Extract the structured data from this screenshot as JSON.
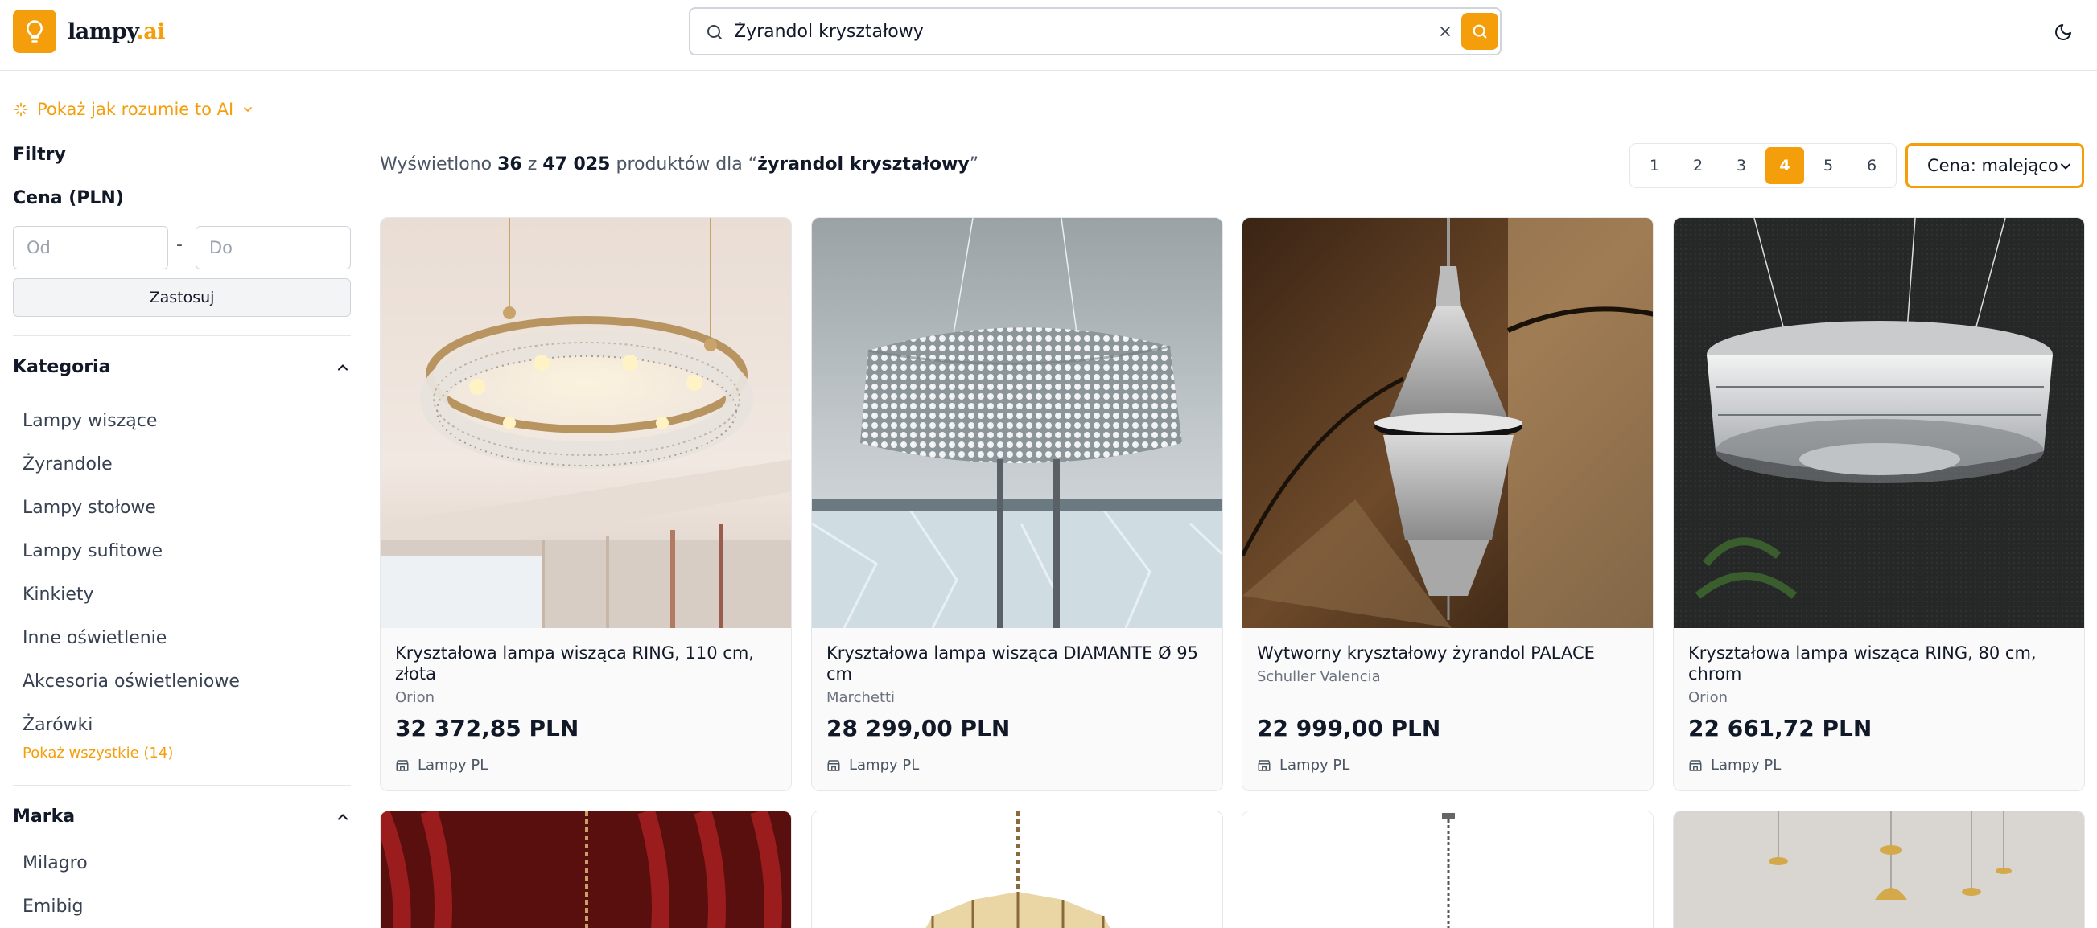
{
  "header": {
    "logo_text": "lampy",
    "logo_suffix": ".ai",
    "icons": [
      "lightbulb-icon",
      "search-icon",
      "close-icon",
      "moon-icon"
    ],
    "search": {
      "value": "Żyrandol kryształowy"
    }
  },
  "sidebar": {
    "ai_link": "Pokaż jak rozumie to AI",
    "filters_title": "Filtry",
    "price_title": "Cena (PLN)",
    "price_from_placeholder": "Od",
    "price_dash": "-",
    "price_to_placeholder": "Do",
    "apply_label": "Zastosuj",
    "category": {
      "title": "Kategoria",
      "items": [
        "Lampy wiszące",
        "Żyrandole",
        "Lampy stołowe",
        "Lampy sufitowe",
        "Kinkiety",
        "Inne oświetlenie",
        "Akcesoria oświetleniowe",
        "Żarówki"
      ],
      "show_all": "Pokaż wszystkie (14)"
    },
    "brand": {
      "title": "Marka",
      "items": [
        "Milagro",
        "Emibig"
      ]
    }
  },
  "results": {
    "prefix": "Wyświetlono",
    "shown": "36",
    "of_word": "z",
    "total": "47 025",
    "middle": "produktów dla “",
    "query": "żyrandol kryształowy",
    "suffix": "”"
  },
  "pagination": {
    "pages": [
      "1",
      "2",
      "3",
      "4",
      "5",
      "6"
    ],
    "active": "4"
  },
  "sort": {
    "value": "Cena: malejąco"
  },
  "accent_color": "#f59e0b",
  "products": [
    {
      "title": "Kryształowa lampa wisząca RING, 110 cm, złota",
      "brand": "Orion",
      "price": "32 372,85 PLN",
      "shop": "Lampy PL"
    },
    {
      "title": "Kryształowa lampa wisząca DIAMANTE Ø 95 cm",
      "brand": "Marchetti",
      "price": "28 299,00 PLN",
      "shop": "Lampy PL"
    },
    {
      "title": "Wytworny kryształowy żyrandol PALACE",
      "brand": "Schuller Valencia",
      "price": "22 999,00 PLN",
      "shop": "Lampy PL"
    },
    {
      "title": "Kryształowa lampa wisząca RING, 80 cm, chrom",
      "brand": "Orion",
      "price": "22 661,72 PLN",
      "shop": "Lampy PL"
    }
  ]
}
